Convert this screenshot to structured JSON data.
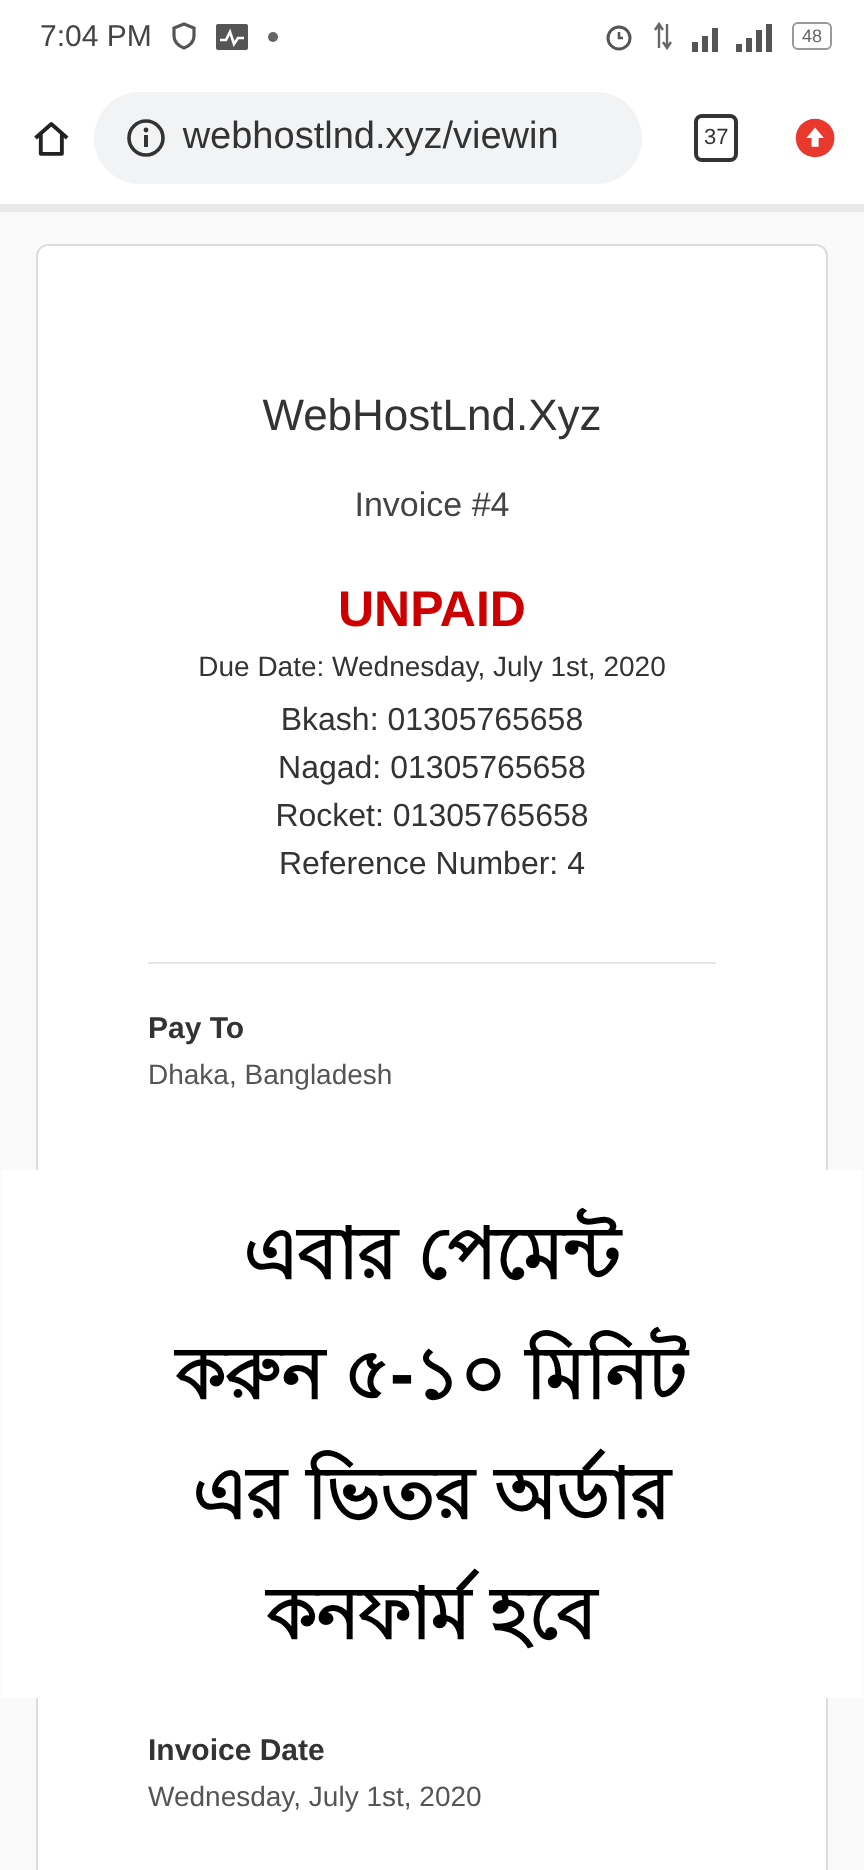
{
  "status_bar": {
    "time": "7:04 PM",
    "battery": "48"
  },
  "browser": {
    "url": "webhostlnd.xyz/viewin",
    "tab_count": "37"
  },
  "invoice": {
    "company": "WebHostLnd.Xyz",
    "title": "Invoice #4",
    "status": "UNPAID",
    "paid": false,
    "due_date": "Due Date: Wednesday, July 1st, 2020",
    "payment_lines": [
      "Bkash: 01305765658",
      "Nagad: 01305765658",
      "Rocket: 01305765658",
      "Reference Number: 4"
    ],
    "sections": [
      {
        "heading": "Pay To",
        "value": "Dhaka, Bangladesh"
      },
      {
        "heading": "Invoice Date",
        "value": "Wednesday, July 1st, 2020"
      }
    ]
  },
  "overlay": {
    "lines": [
      "এবার পেমেন্ট",
      "করুন ৫-১০ মিনিট",
      "এর ভিতর অর্ডার",
      "কনফার্ম হবে"
    ]
  }
}
